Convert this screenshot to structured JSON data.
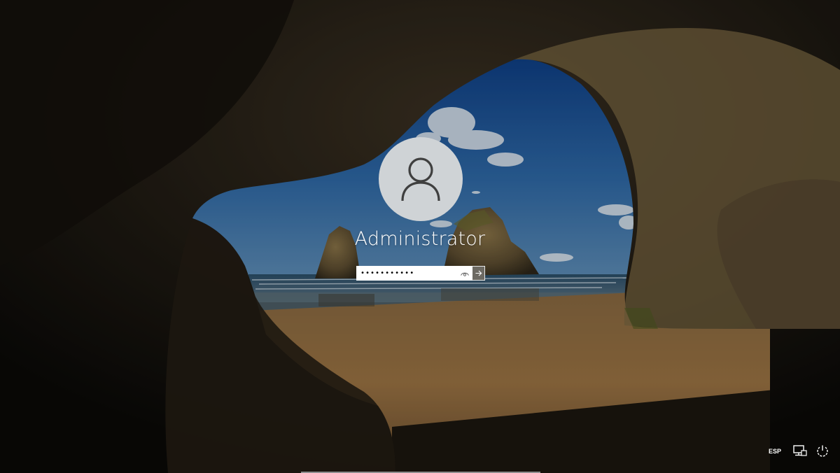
{
  "login": {
    "username": "Administrator",
    "password_value": "•••••••••••",
    "avatar_icon": "user-icon",
    "reveal_icon": "eye-icon",
    "submit_icon": "arrow-right-icon"
  },
  "tray": {
    "language": "ESP",
    "network_icon": "network-icon",
    "power_icon": "power-icon"
  },
  "colors": {
    "field_background": "#ffffff",
    "submit_background": "#6d6a63",
    "avatar_background": "#cfd3d6"
  }
}
